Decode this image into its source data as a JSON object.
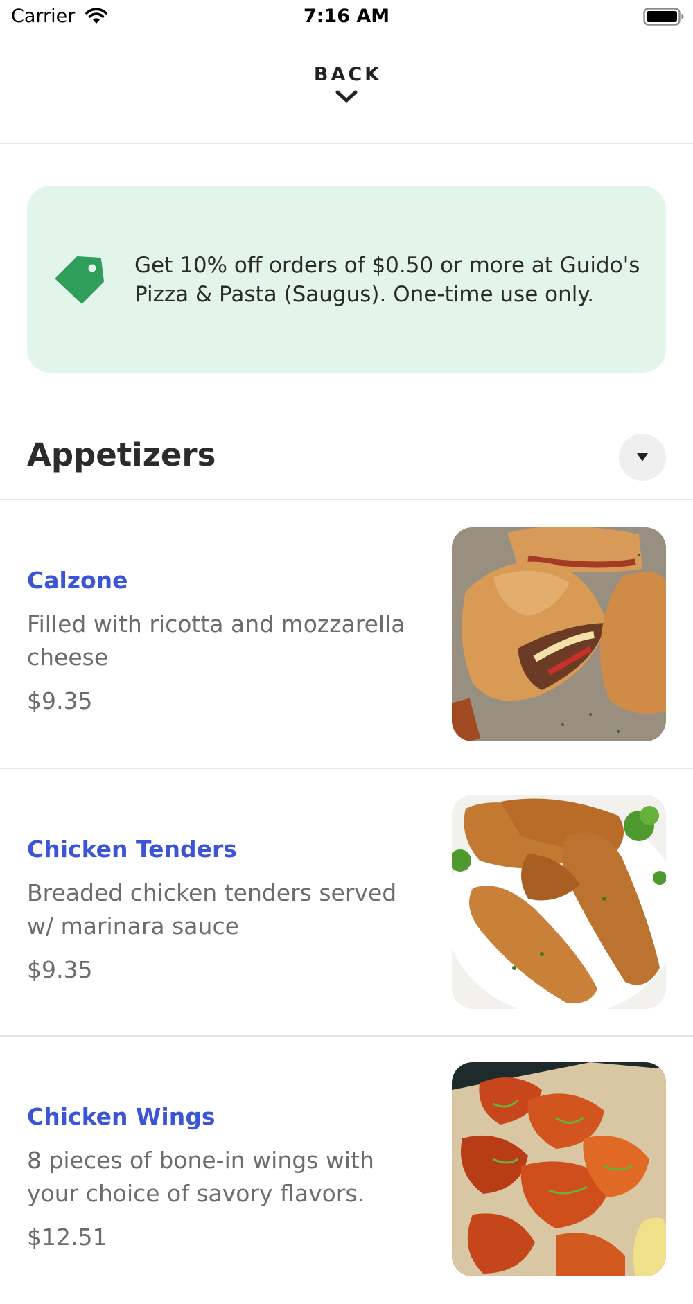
{
  "status_bar": {
    "carrier": "Carrier",
    "time": "7:16 AM",
    "wifi_icon": "wifi-icon",
    "battery_icon": "battery-icon"
  },
  "header": {
    "back_label": "BACK",
    "chevron_icon": "chevron-down-icon"
  },
  "promo": {
    "icon": "tag-icon",
    "text": "Get 10% off orders of $0.50 or more at Guido's Pizza & Pasta (Saugus). One-time use only.",
    "background": "#e3f4ea",
    "icon_color": "#2f9e5b"
  },
  "section": {
    "title": "Appetizers",
    "toggle_icon": "caret-down-icon"
  },
  "colors": {
    "item_name": "#3b55d6",
    "body_text": "#6c6c6c",
    "divider": "#e6e6e6"
  },
  "menu_items": [
    {
      "name": "Calzone",
      "description": "Filled with ricotta and mozzarella cheese",
      "price": "$9.35",
      "image": "calzone-photo"
    },
    {
      "name": "Chicken Tenders",
      "description": "Breaded chicken tenders served w/ marinara sauce",
      "price": "$9.35",
      "image": "chicken-tenders-photo"
    },
    {
      "name": "Chicken Wings",
      "description": "8 pieces of bone-in wings with your choice of savory flavors.",
      "price": "$12.51",
      "image": "chicken-wings-photo"
    }
  ]
}
